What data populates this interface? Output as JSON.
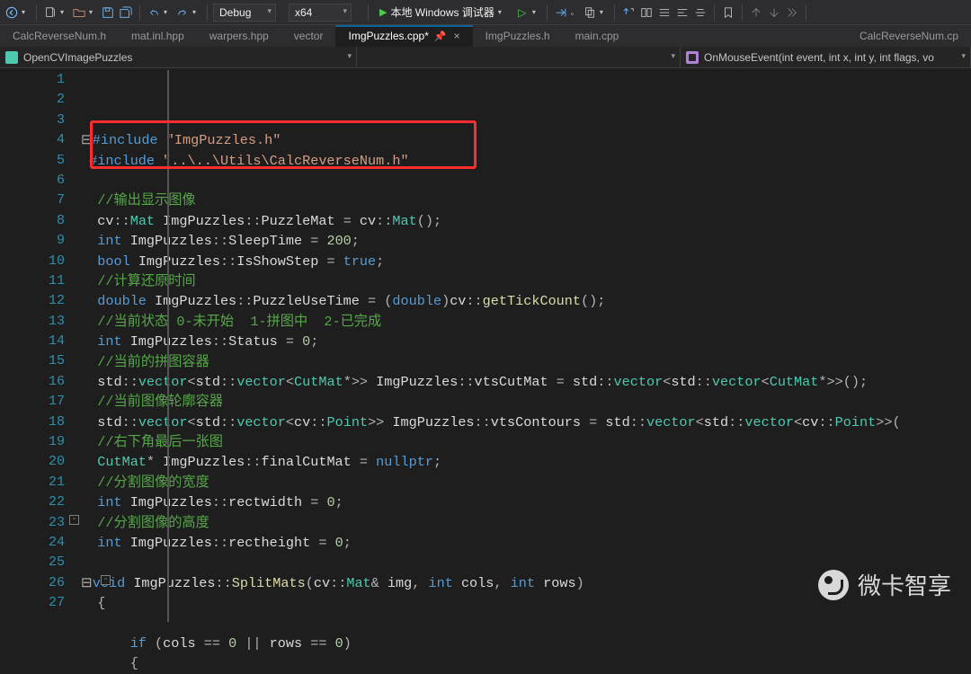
{
  "toolbar": {
    "config": "Debug",
    "platform": "x64",
    "start": "本地 Windows 调试器"
  },
  "tabs": [
    {
      "label": "CalcReverseNum.h"
    },
    {
      "label": "mat.inl.hpp"
    },
    {
      "label": "warpers.hpp"
    },
    {
      "label": "vector"
    },
    {
      "label": "ImgPuzzles.cpp*",
      "active": true
    },
    {
      "label": "ImgPuzzles.h"
    },
    {
      "label": "main.cpp"
    },
    {
      "label": "CalcReverseNum.cp",
      "overflow": true
    }
  ],
  "navbar": {
    "scope": "OpenCVImagePuzzles",
    "class": "ImgPuzzles",
    "member": "OnMouseEvent(int event, int x, int y, int flags, vo"
  },
  "first_line_number": 1,
  "code_lines": [
    [
      [
        "punc",
        "⊟"
      ],
      [
        "key",
        "#include "
      ],
      [
        "str",
        "\"ImgPuzzles.h\""
      ]
    ],
    [
      [
        "punc",
        " "
      ],
      [
        "key",
        "#include "
      ],
      [
        "str",
        "\"..\\..\\Utils\\CalcReverseNum.h\""
      ]
    ],
    [],
    [
      [
        "id",
        "  "
      ],
      [
        "cmt",
        "//输出显示图像"
      ]
    ],
    [
      [
        "id",
        "  "
      ],
      [
        "id",
        "cv"
      ],
      [
        "punc",
        "::"
      ],
      [
        "type",
        "Mat"
      ],
      [
        "id",
        " ImgPuzzles"
      ],
      [
        "punc",
        "::"
      ],
      [
        "id",
        "PuzzleMat "
      ],
      [
        "punc",
        "= "
      ],
      [
        "id",
        "cv"
      ],
      [
        "punc",
        "::"
      ],
      [
        "type",
        "Mat"
      ],
      [
        "punc",
        "();"
      ]
    ],
    [
      [
        "id",
        "  "
      ],
      [
        "key",
        "int"
      ],
      [
        "id",
        " ImgPuzzles"
      ],
      [
        "punc",
        "::"
      ],
      [
        "id",
        "SleepTime "
      ],
      [
        "punc",
        "= "
      ],
      [
        "num",
        "200"
      ],
      [
        "punc",
        ";"
      ]
    ],
    [
      [
        "id",
        "  "
      ],
      [
        "key",
        "bool"
      ],
      [
        "id",
        " ImgPuzzles"
      ],
      [
        "punc",
        "::"
      ],
      [
        "id",
        "IsShowStep "
      ],
      [
        "punc",
        "= "
      ],
      [
        "key",
        "true"
      ],
      [
        "punc",
        ";"
      ]
    ],
    [
      [
        "id",
        "  "
      ],
      [
        "cmt",
        "//计算还原时间"
      ]
    ],
    [
      [
        "id",
        "  "
      ],
      [
        "key",
        "double"
      ],
      [
        "id",
        " ImgPuzzles"
      ],
      [
        "punc",
        "::"
      ],
      [
        "id",
        "PuzzleUseTime "
      ],
      [
        "punc",
        "= ("
      ],
      [
        "key",
        "double"
      ],
      [
        "punc",
        ")"
      ],
      [
        "id",
        "cv"
      ],
      [
        "punc",
        "::"
      ],
      [
        "fn",
        "getTickCount"
      ],
      [
        "punc",
        "();"
      ]
    ],
    [
      [
        "id",
        "  "
      ],
      [
        "cmt",
        "//当前状态 0-未开始  1-拼图中  2-已完成"
      ]
    ],
    [
      [
        "id",
        "  "
      ],
      [
        "key",
        "int"
      ],
      [
        "id",
        " ImgPuzzles"
      ],
      [
        "punc",
        "::"
      ],
      [
        "id",
        "Status "
      ],
      [
        "punc",
        "= "
      ],
      [
        "num",
        "0"
      ],
      [
        "punc",
        ";"
      ]
    ],
    [
      [
        "id",
        "  "
      ],
      [
        "cmt",
        "//当前的拼图容器"
      ]
    ],
    [
      [
        "id",
        "  "
      ],
      [
        "id",
        "std"
      ],
      [
        "punc",
        "::"
      ],
      [
        "type",
        "vector"
      ],
      [
        "punc",
        "<"
      ],
      [
        "id",
        "std"
      ],
      [
        "punc",
        "::"
      ],
      [
        "type",
        "vector"
      ],
      [
        "punc",
        "<"
      ],
      [
        "type",
        "CutMat"
      ],
      [
        "punc",
        "*>> "
      ],
      [
        "id",
        "ImgPuzzles"
      ],
      [
        "punc",
        "::"
      ],
      [
        "id",
        "vtsCutMat "
      ],
      [
        "punc",
        "= "
      ],
      [
        "id",
        "std"
      ],
      [
        "punc",
        "::"
      ],
      [
        "type",
        "vector"
      ],
      [
        "punc",
        "<"
      ],
      [
        "id",
        "std"
      ],
      [
        "punc",
        "::"
      ],
      [
        "type",
        "vector"
      ],
      [
        "punc",
        "<"
      ],
      [
        "type",
        "CutMat"
      ],
      [
        "punc",
        "*>>();"
      ]
    ],
    [
      [
        "id",
        "  "
      ],
      [
        "cmt",
        "//当前图像轮廓容器"
      ]
    ],
    [
      [
        "id",
        "  "
      ],
      [
        "id",
        "std"
      ],
      [
        "punc",
        "::"
      ],
      [
        "type",
        "vector"
      ],
      [
        "punc",
        "<"
      ],
      [
        "id",
        "std"
      ],
      [
        "punc",
        "::"
      ],
      [
        "type",
        "vector"
      ],
      [
        "punc",
        "<"
      ],
      [
        "id",
        "cv"
      ],
      [
        "punc",
        "::"
      ],
      [
        "type",
        "Point"
      ],
      [
        "punc",
        ">> "
      ],
      [
        "id",
        "ImgPuzzles"
      ],
      [
        "punc",
        "::"
      ],
      [
        "id",
        "vtsContours "
      ],
      [
        "punc",
        "= "
      ],
      [
        "id",
        "std"
      ],
      [
        "punc",
        "::"
      ],
      [
        "type",
        "vector"
      ],
      [
        "punc",
        "<"
      ],
      [
        "id",
        "std"
      ],
      [
        "punc",
        "::"
      ],
      [
        "type",
        "vector"
      ],
      [
        "punc",
        "<"
      ],
      [
        "id",
        "cv"
      ],
      [
        "punc",
        "::"
      ],
      [
        "type",
        "Point"
      ],
      [
        "punc",
        ">>("
      ]
    ],
    [
      [
        "id",
        "  "
      ],
      [
        "cmt",
        "//右下角最后一张图"
      ]
    ],
    [
      [
        "id",
        "  "
      ],
      [
        "type",
        "CutMat"
      ],
      [
        "punc",
        "* "
      ],
      [
        "id",
        "ImgPuzzles"
      ],
      [
        "punc",
        "::"
      ],
      [
        "id",
        "finalCutMat "
      ],
      [
        "punc",
        "= "
      ],
      [
        "key",
        "nullptr"
      ],
      [
        "punc",
        ";"
      ]
    ],
    [
      [
        "id",
        "  "
      ],
      [
        "cmt",
        "//分割图像的宽度"
      ]
    ],
    [
      [
        "id",
        "  "
      ],
      [
        "key",
        "int"
      ],
      [
        "id",
        " ImgPuzzles"
      ],
      [
        "punc",
        "::"
      ],
      [
        "id",
        "rectwidth "
      ],
      [
        "punc",
        "= "
      ],
      [
        "num",
        "0"
      ],
      [
        "punc",
        ";"
      ]
    ],
    [
      [
        "id",
        "  "
      ],
      [
        "cmt",
        "//分割图像的高度"
      ]
    ],
    [
      [
        "id",
        "  "
      ],
      [
        "key",
        "int"
      ],
      [
        "id",
        " ImgPuzzles"
      ],
      [
        "punc",
        "::"
      ],
      [
        "id",
        "rectheight "
      ],
      [
        "punc",
        "= "
      ],
      [
        "num",
        "0"
      ],
      [
        "punc",
        ";"
      ]
    ],
    [],
    [
      [
        "punc",
        "⊟"
      ],
      [
        "key",
        "void"
      ],
      [
        "id",
        " ImgPuzzles"
      ],
      [
        "punc",
        "::"
      ],
      [
        "fn",
        "SplitMats"
      ],
      [
        "punc",
        "("
      ],
      [
        "id",
        "cv"
      ],
      [
        "punc",
        "::"
      ],
      [
        "type",
        "Mat"
      ],
      [
        "punc",
        "& "
      ],
      [
        "id",
        "img"
      ],
      [
        "punc",
        ", "
      ],
      [
        "key",
        "int"
      ],
      [
        "id",
        " cols"
      ],
      [
        "punc",
        ", "
      ],
      [
        "key",
        "int"
      ],
      [
        "id",
        " rows"
      ],
      [
        "punc",
        ")"
      ]
    ],
    [
      [
        "id",
        "  "
      ],
      [
        "punc",
        "{"
      ]
    ],
    [],
    [
      [
        "id",
        "      "
      ],
      [
        "key",
        "if"
      ],
      [
        "punc",
        " ("
      ],
      [
        "id",
        "cols "
      ],
      [
        "punc",
        "== "
      ],
      [
        "num",
        "0"
      ],
      [
        "punc",
        " || "
      ],
      [
        "id",
        "rows "
      ],
      [
        "punc",
        "== "
      ],
      [
        "num",
        "0"
      ],
      [
        "punc",
        ")"
      ]
    ],
    [
      [
        "id",
        "      "
      ],
      [
        "punc",
        "{"
      ]
    ]
  ],
  "watermark": "微卡智享"
}
